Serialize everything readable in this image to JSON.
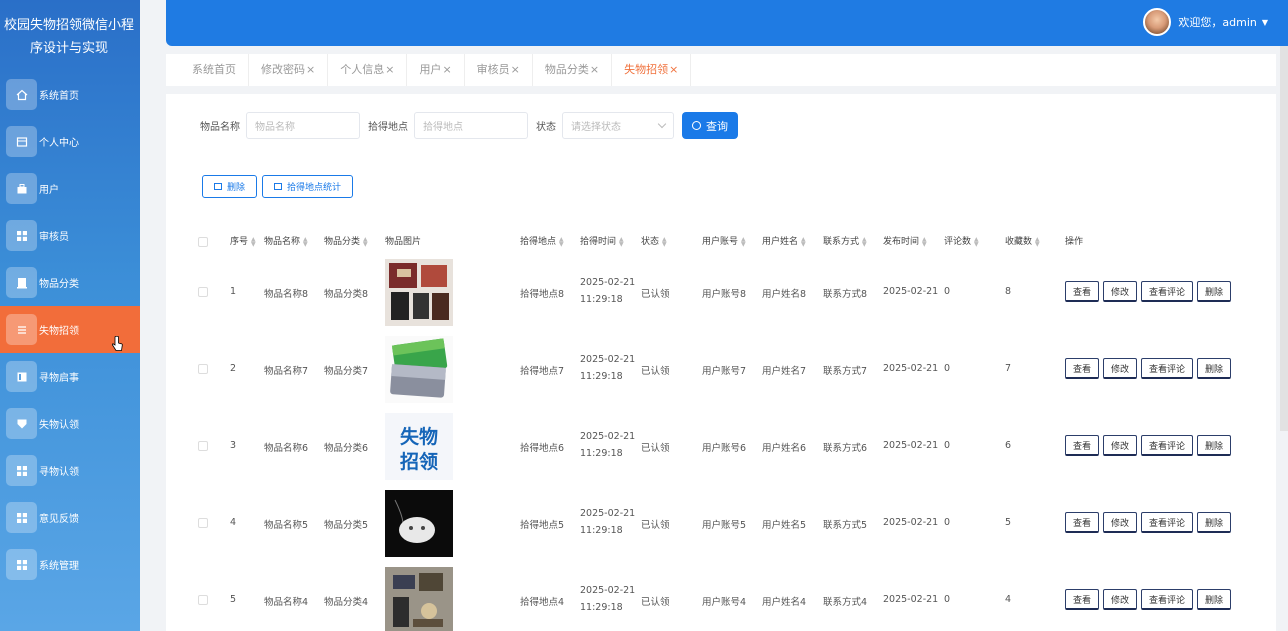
{
  "app": {
    "title": "校园失物招领微信小程序设计与实现"
  },
  "sidebar": {
    "items": [
      {
        "label": "系统首页",
        "icon": "home-icon",
        "active": false
      },
      {
        "label": "个人中心",
        "icon": "profile-icon",
        "active": false
      },
      {
        "label": "用户",
        "icon": "user-icon",
        "active": false
      },
      {
        "label": "审核员",
        "icon": "grid-icon",
        "active": false
      },
      {
        "label": "物品分类",
        "icon": "category-icon",
        "active": false
      },
      {
        "label": "失物招领",
        "icon": "list-icon",
        "active": true
      },
      {
        "label": "寻物启事",
        "icon": "notice-icon",
        "active": false
      },
      {
        "label": "失物认领",
        "icon": "claim-icon",
        "active": false
      },
      {
        "label": "寻物认领",
        "icon": "grid-icon",
        "active": false
      },
      {
        "label": "意见反馈",
        "icon": "feedback-icon",
        "active": false
      },
      {
        "label": "系统管理",
        "icon": "grid-icon",
        "active": false
      }
    ]
  },
  "header": {
    "welcome": "欢迎您，admin",
    "caret": "▼"
  },
  "tabs": [
    {
      "label": "系统首页",
      "closable": false,
      "active": false
    },
    {
      "label": "修改密码",
      "closable": true,
      "active": false
    },
    {
      "label": "个人信息",
      "closable": true,
      "active": false
    },
    {
      "label": "用户",
      "closable": true,
      "active": false
    },
    {
      "label": "审核员",
      "closable": true,
      "active": false
    },
    {
      "label": "物品分类",
      "closable": true,
      "active": false
    },
    {
      "label": "失物招领",
      "closable": true,
      "active": true
    }
  ],
  "tab_close": "×",
  "search": {
    "name_label": "物品名称",
    "name_placeholder": "物品名称",
    "place_label": "拾得地点",
    "place_placeholder": "拾得地点",
    "status_label": "状态",
    "status_placeholder": "请选择状态",
    "query_label": "查询"
  },
  "actions": {
    "delete_label": "删除",
    "stats_label": "拾得地点统计"
  },
  "table": {
    "headers": [
      "序号",
      "物品名称",
      "物品分类",
      "物品图片",
      "拾得地点",
      "拾得时间",
      "状态",
      "用户账号",
      "用户姓名",
      "联系方式",
      "发布时间",
      "评论数",
      "收藏数",
      "操作"
    ],
    "op_labels": [
      "查看",
      "修改",
      "查看评论",
      "删除"
    ],
    "rows": [
      {
        "no": "1",
        "name": "物品名称8",
        "cat": "物品分类8",
        "place": "拾得地点8",
        "date": "2025-02-21",
        "time": "11:29:18",
        "status": "已认领",
        "account": "用户账号8",
        "uname": "用户姓名8",
        "contact": "联系方式8",
        "pub": "2025-02-21",
        "comments": "0",
        "favs": "8",
        "img": "wallet"
      },
      {
        "no": "2",
        "name": "物品名称7",
        "cat": "物品分类7",
        "place": "拾得地点7",
        "date": "2025-02-21",
        "time": "11:29:18",
        "status": "已认领",
        "account": "用户账号7",
        "uname": "用户姓名7",
        "contact": "联系方式7",
        "pub": "2025-02-21",
        "comments": "0",
        "favs": "7",
        "img": "cards"
      },
      {
        "no": "3",
        "name": "物品名称6",
        "cat": "物品分类6",
        "place": "拾得地点6",
        "date": "2025-02-21",
        "time": "11:29:18",
        "status": "已认领",
        "account": "用户账号6",
        "uname": "用户姓名6",
        "contact": "联系方式6",
        "pub": "2025-02-21",
        "comments": "0",
        "favs": "6",
        "img": "poster",
        "img_text_1": "失物",
        "img_text_2": "招领"
      },
      {
        "no": "4",
        "name": "物品名称5",
        "cat": "物品分类5",
        "place": "拾得地点5",
        "date": "2025-02-21",
        "time": "11:29:18",
        "status": "已认领",
        "account": "用户账号5",
        "uname": "用户姓名5",
        "contact": "联系方式5",
        "pub": "2025-02-21",
        "comments": "0",
        "favs": "5",
        "img": "earbuds"
      },
      {
        "no": "5",
        "name": "物品名称4",
        "cat": "物品分类4",
        "place": "拾得地点4",
        "date": "2025-02-21",
        "time": "11:29:18",
        "status": "已认领",
        "account": "用户账号4",
        "uname": "用户姓名4",
        "contact": "联系方式4",
        "pub": "2025-02-21",
        "comments": "0",
        "favs": "4",
        "img": "items"
      }
    ]
  },
  "colors": {
    "primary": "#1a7ae8",
    "active_menu": "#f26d3a",
    "active_tab": "#f0713c"
  }
}
